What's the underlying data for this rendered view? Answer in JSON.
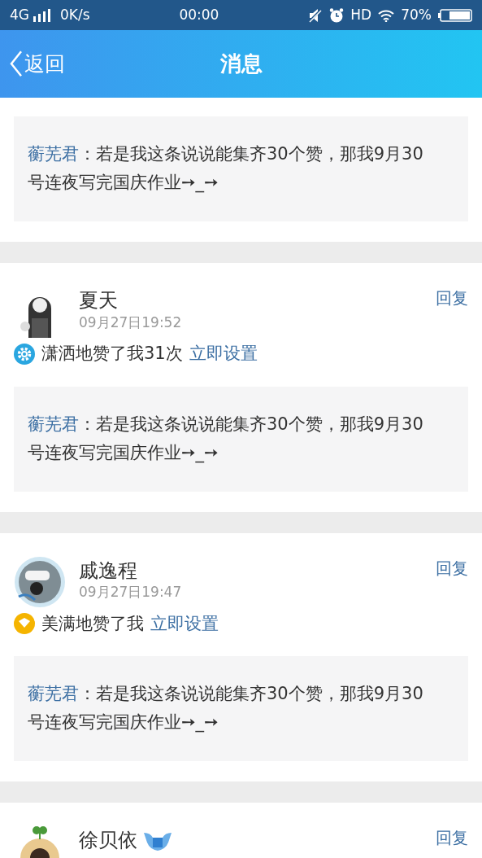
{
  "status_bar": {
    "network": "4G",
    "speed": "0K/s",
    "time": "00:00",
    "hd": "HD",
    "battery": "70%"
  },
  "header": {
    "back": "返回",
    "title": "消息"
  },
  "messages": [
    {
      "quote": {
        "author": "蘅芜君",
        "text": "：若是我这条说说能集齐30个赞，那我9月30号连夜写完国庆作业➙_➙"
      }
    },
    {
      "name": "夏天",
      "reply": "回复",
      "date": "09月27日19:52",
      "like": {
        "kind": "gear",
        "text": "潇洒地赞了我31次",
        "action": "立即设置"
      },
      "quote": {
        "author": "蘅芜君",
        "text": "：若是我这条说说能集齐30个赞，那我9月30号连夜写完国庆作业➙_➙"
      }
    },
    {
      "name": "戚逸程",
      "reply": "回复",
      "date": "09月27日19:47",
      "like": {
        "kind": "heart",
        "text": "美满地赞了我",
        "action": "立即设置"
      },
      "quote": {
        "author": "蘅芜君",
        "text": "：若是我这条说说能集齐30个赞，那我9月30号连夜写完国庆作业➙_➙"
      }
    },
    {
      "name": "徐贝依",
      "badge": true,
      "reply": "回复"
    }
  ]
}
